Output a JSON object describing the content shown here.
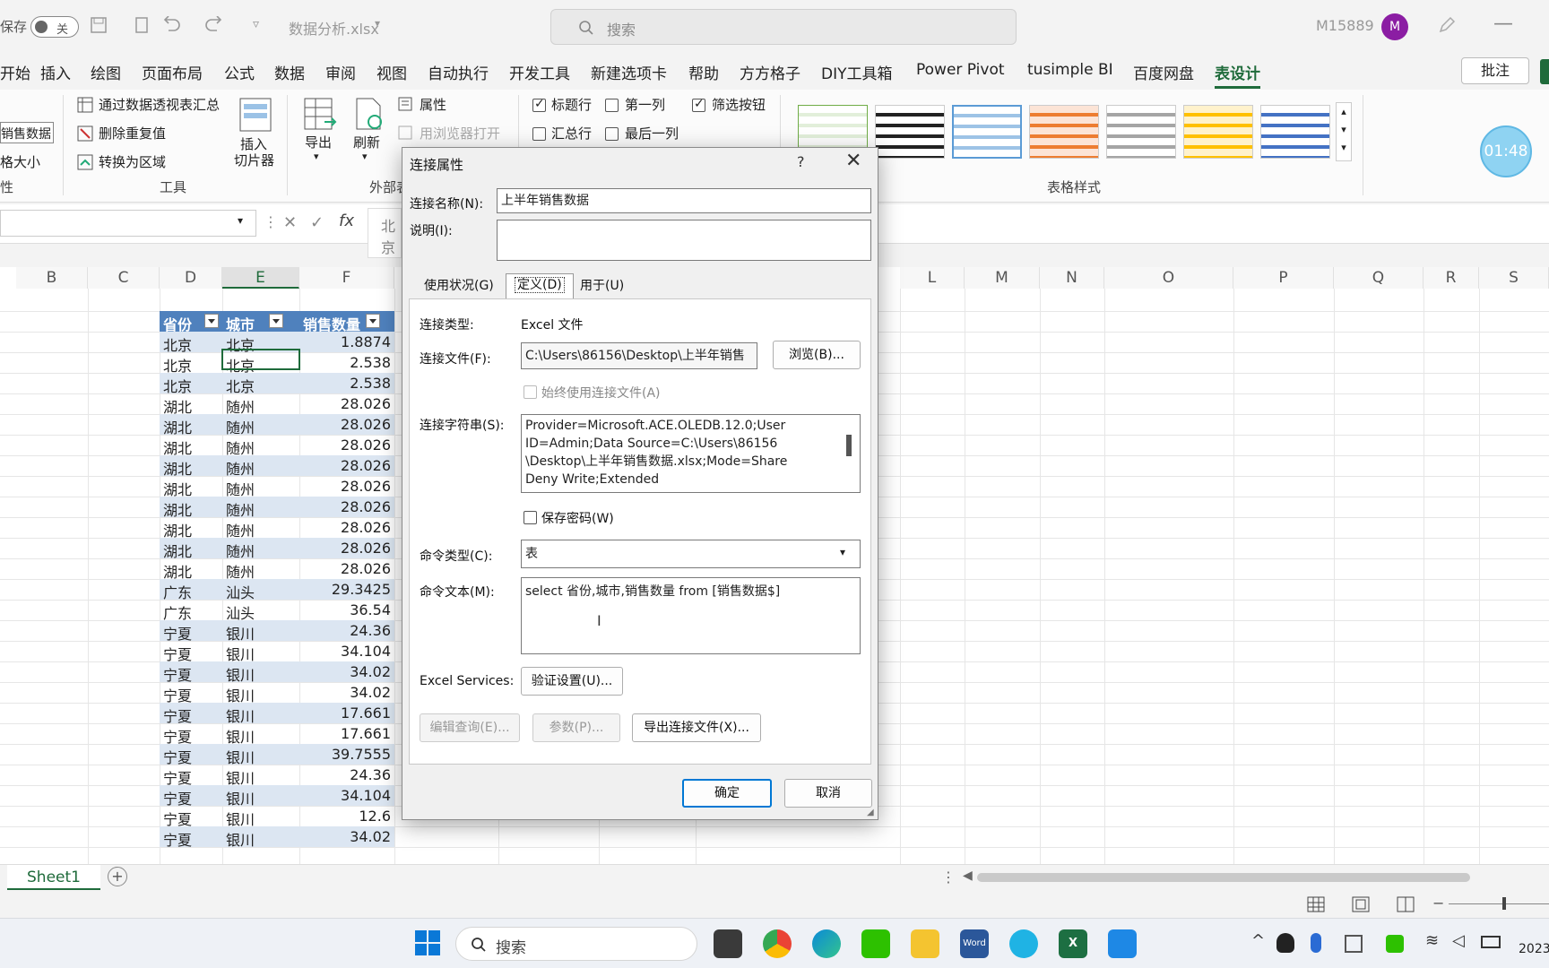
{
  "titlebar": {
    "autosave": "保存",
    "autosave_state": "关",
    "filename": "数据分析.xlsx",
    "search_placeholder": "搜索",
    "user": "M15889",
    "avatar_letter": "M"
  },
  "menu": {
    "tabs": [
      "开始",
      "插入",
      "绘图",
      "页面布局",
      "公式",
      "数据",
      "审阅",
      "视图",
      "自动执行",
      "开发工具",
      "新建选项卡",
      "帮助",
      "方方格子",
      "DIY工具箱",
      "Power Pivot",
      "tusimple BI",
      "百度网盘",
      "表设计"
    ],
    "active": "表设计",
    "comment_btn": "批注"
  },
  "ribbon": {
    "table_name_value": "销售数据",
    "resize": "格大小",
    "group_props": "性",
    "pivot_summary": "通过数据透视表汇总",
    "remove_dupes": "删除重复值",
    "convert_range": "转换为区域",
    "tools_group": "工具",
    "insert_slicer": "插入",
    "insert_slicer2": "切片器",
    "export": "导出",
    "refresh": "刷新",
    "properties": "属性",
    "open_browser": "用浏览器打开",
    "external_group": "外部表",
    "opts": {
      "header_row": "标题行",
      "first_col": "第一列",
      "filter_btn": "筛选按钮",
      "total_row": "汇总行",
      "last_col": "最后一列"
    },
    "styles_group": "表格样式",
    "timer": "01:48"
  },
  "formula": {
    "partial": "北京",
    "fx": "fx"
  },
  "sheet": {
    "columns": [
      "B",
      "C",
      "D",
      "E",
      "F",
      "L",
      "M",
      "N",
      "O",
      "P",
      "Q",
      "R",
      "S"
    ],
    "table_headers": [
      "省份",
      "城市",
      "销售数量"
    ],
    "rows": [
      [
        "北京",
        "北京",
        "1.8874"
      ],
      [
        "北京",
        "北京",
        "2.538"
      ],
      [
        "北京",
        "北京",
        "2.538"
      ],
      [
        "湖北",
        "随州",
        "28.026"
      ],
      [
        "湖北",
        "随州",
        "28.026"
      ],
      [
        "湖北",
        "随州",
        "28.026"
      ],
      [
        "湖北",
        "随州",
        "28.026"
      ],
      [
        "湖北",
        "随州",
        "28.026"
      ],
      [
        "湖北",
        "随州",
        "28.026"
      ],
      [
        "湖北",
        "随州",
        "28.026"
      ],
      [
        "湖北",
        "随州",
        "28.026"
      ],
      [
        "湖北",
        "随州",
        "28.026"
      ],
      [
        "广东",
        "汕头",
        "29.3425"
      ],
      [
        "广东",
        "汕头",
        "36.54"
      ],
      [
        "宁夏",
        "银川",
        "24.36"
      ],
      [
        "宁夏",
        "银川",
        "34.104"
      ],
      [
        "宁夏",
        "银川",
        "34.02"
      ],
      [
        "宁夏",
        "银川",
        "34.02"
      ],
      [
        "宁夏",
        "银川",
        "17.661"
      ],
      [
        "宁夏",
        "银川",
        "17.661"
      ],
      [
        "宁夏",
        "银川",
        "39.7555"
      ],
      [
        "宁夏",
        "银川",
        "24.36"
      ],
      [
        "宁夏",
        "银川",
        "34.104"
      ],
      [
        "宁夏",
        "银川",
        "12.6"
      ],
      [
        "宁夏",
        "银川",
        "34.02"
      ]
    ],
    "sheet_tab": "Sheet1"
  },
  "dialog": {
    "title": "连接属性",
    "help": "?",
    "conn_name_label": "连接名称(N):",
    "conn_name_value": "上半年销售数据",
    "desc_label": "说明(I):",
    "tabs": [
      "使用状况(G)",
      "定义(D)",
      "用于(U)"
    ],
    "active_tab": "定义(D)",
    "conn_type_label": "连接类型:",
    "conn_type_value": "Excel 文件",
    "conn_file_label": "连接文件(F):",
    "conn_file_value": "C:\\Users\\86156\\Desktop\\上半年销售",
    "browse_btn": "浏览(B)...",
    "always_use": "始终使用连接文件(A)",
    "conn_string_label": "连接字符串(S):",
    "conn_string_lines": [
      "Provider=Microsoft.ACE.OLEDB.12.0;User",
      "ID=Admin;Data Source=C:\\Users\\86156",
      "\\Desktop\\上半年销售数据.xlsx;Mode=Share",
      "Deny Write;Extended"
    ],
    "save_pw": "保存密码(W)",
    "cmd_type_label": "命令类型(C):",
    "cmd_type_value": "表",
    "cmd_text_label": "命令文本(M):",
    "cmd_text_value": "select 省份,城市,销售数量 from [销售数据$]",
    "excel_services_label": "Excel Services:",
    "auth_btn": "验证设置(U)...",
    "edit_query_btn": "编辑查询(E)...",
    "params_btn": "参数(P)...",
    "export_conn_btn": "导出连接文件(X)...",
    "ok_btn": "确定",
    "cancel_btn": "取消"
  },
  "taskbar": {
    "search": "搜索",
    "year": "2023"
  }
}
